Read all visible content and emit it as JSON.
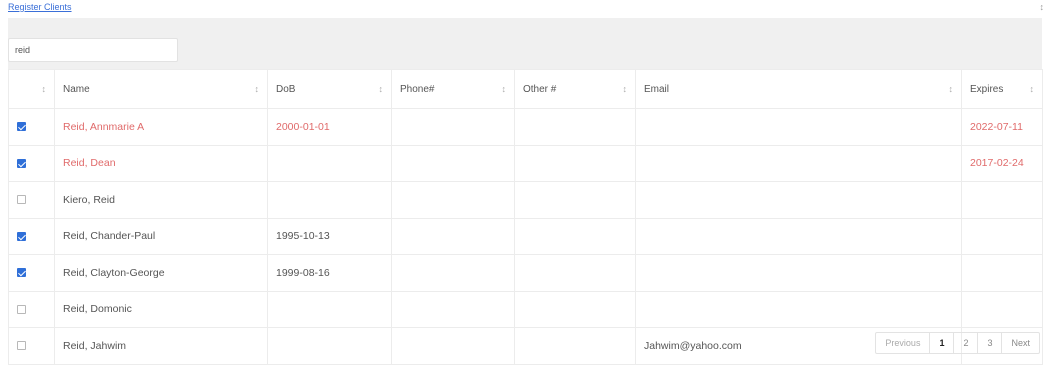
{
  "header": {
    "link_label": "Register Clients",
    "scroll_glyph": "↕"
  },
  "search": {
    "value": "reid",
    "placeholder": ""
  },
  "table": {
    "columns": [
      {
        "label": ""
      },
      {
        "label": "Name"
      },
      {
        "label": "DoB"
      },
      {
        "label": "Phone#"
      },
      {
        "label": "Other #"
      },
      {
        "label": "Email"
      },
      {
        "label": "Expires"
      }
    ],
    "sort_glyph": "↕",
    "rows": [
      {
        "checked": true,
        "flag": true,
        "name": "Reid, Annmarie A",
        "dob": "2000-01-01",
        "phone": "",
        "other": "",
        "email": "",
        "expires": "2022-07-11"
      },
      {
        "checked": true,
        "flag": true,
        "name": "Reid, Dean",
        "dob": "",
        "phone": "",
        "other": "",
        "email": "",
        "expires": "2017-02-24"
      },
      {
        "checked": false,
        "flag": false,
        "name": "Kiero, Reid",
        "dob": "",
        "phone": "",
        "other": "",
        "email": "",
        "expires": ""
      },
      {
        "checked": true,
        "flag": false,
        "name": "Reid, Chander-Paul",
        "dob": "1995-10-13",
        "phone": "",
        "other": "",
        "email": "",
        "expires": ""
      },
      {
        "checked": true,
        "flag": false,
        "name": "Reid, Clayton-George",
        "dob": "1999-08-16",
        "phone": "",
        "other": "",
        "email": "",
        "expires": ""
      },
      {
        "checked": false,
        "flag": false,
        "name": "Reid, Domonic",
        "dob": "",
        "phone": "",
        "other": "",
        "email": "",
        "expires": ""
      },
      {
        "checked": false,
        "flag": false,
        "name": "Reid, Jahwim",
        "dob": "",
        "phone": "",
        "other": "",
        "email": "Jahwim@yahoo.com",
        "expires": ""
      }
    ]
  },
  "pagination": {
    "previous_label": "Previous",
    "pages": [
      "1",
      "2",
      "3"
    ],
    "active_page": "1",
    "next_label": "Next"
  },
  "colors": {
    "link": "#3a6fd8",
    "flagged_text": "#e06a6a",
    "checkbox": "#2f6fd8"
  }
}
